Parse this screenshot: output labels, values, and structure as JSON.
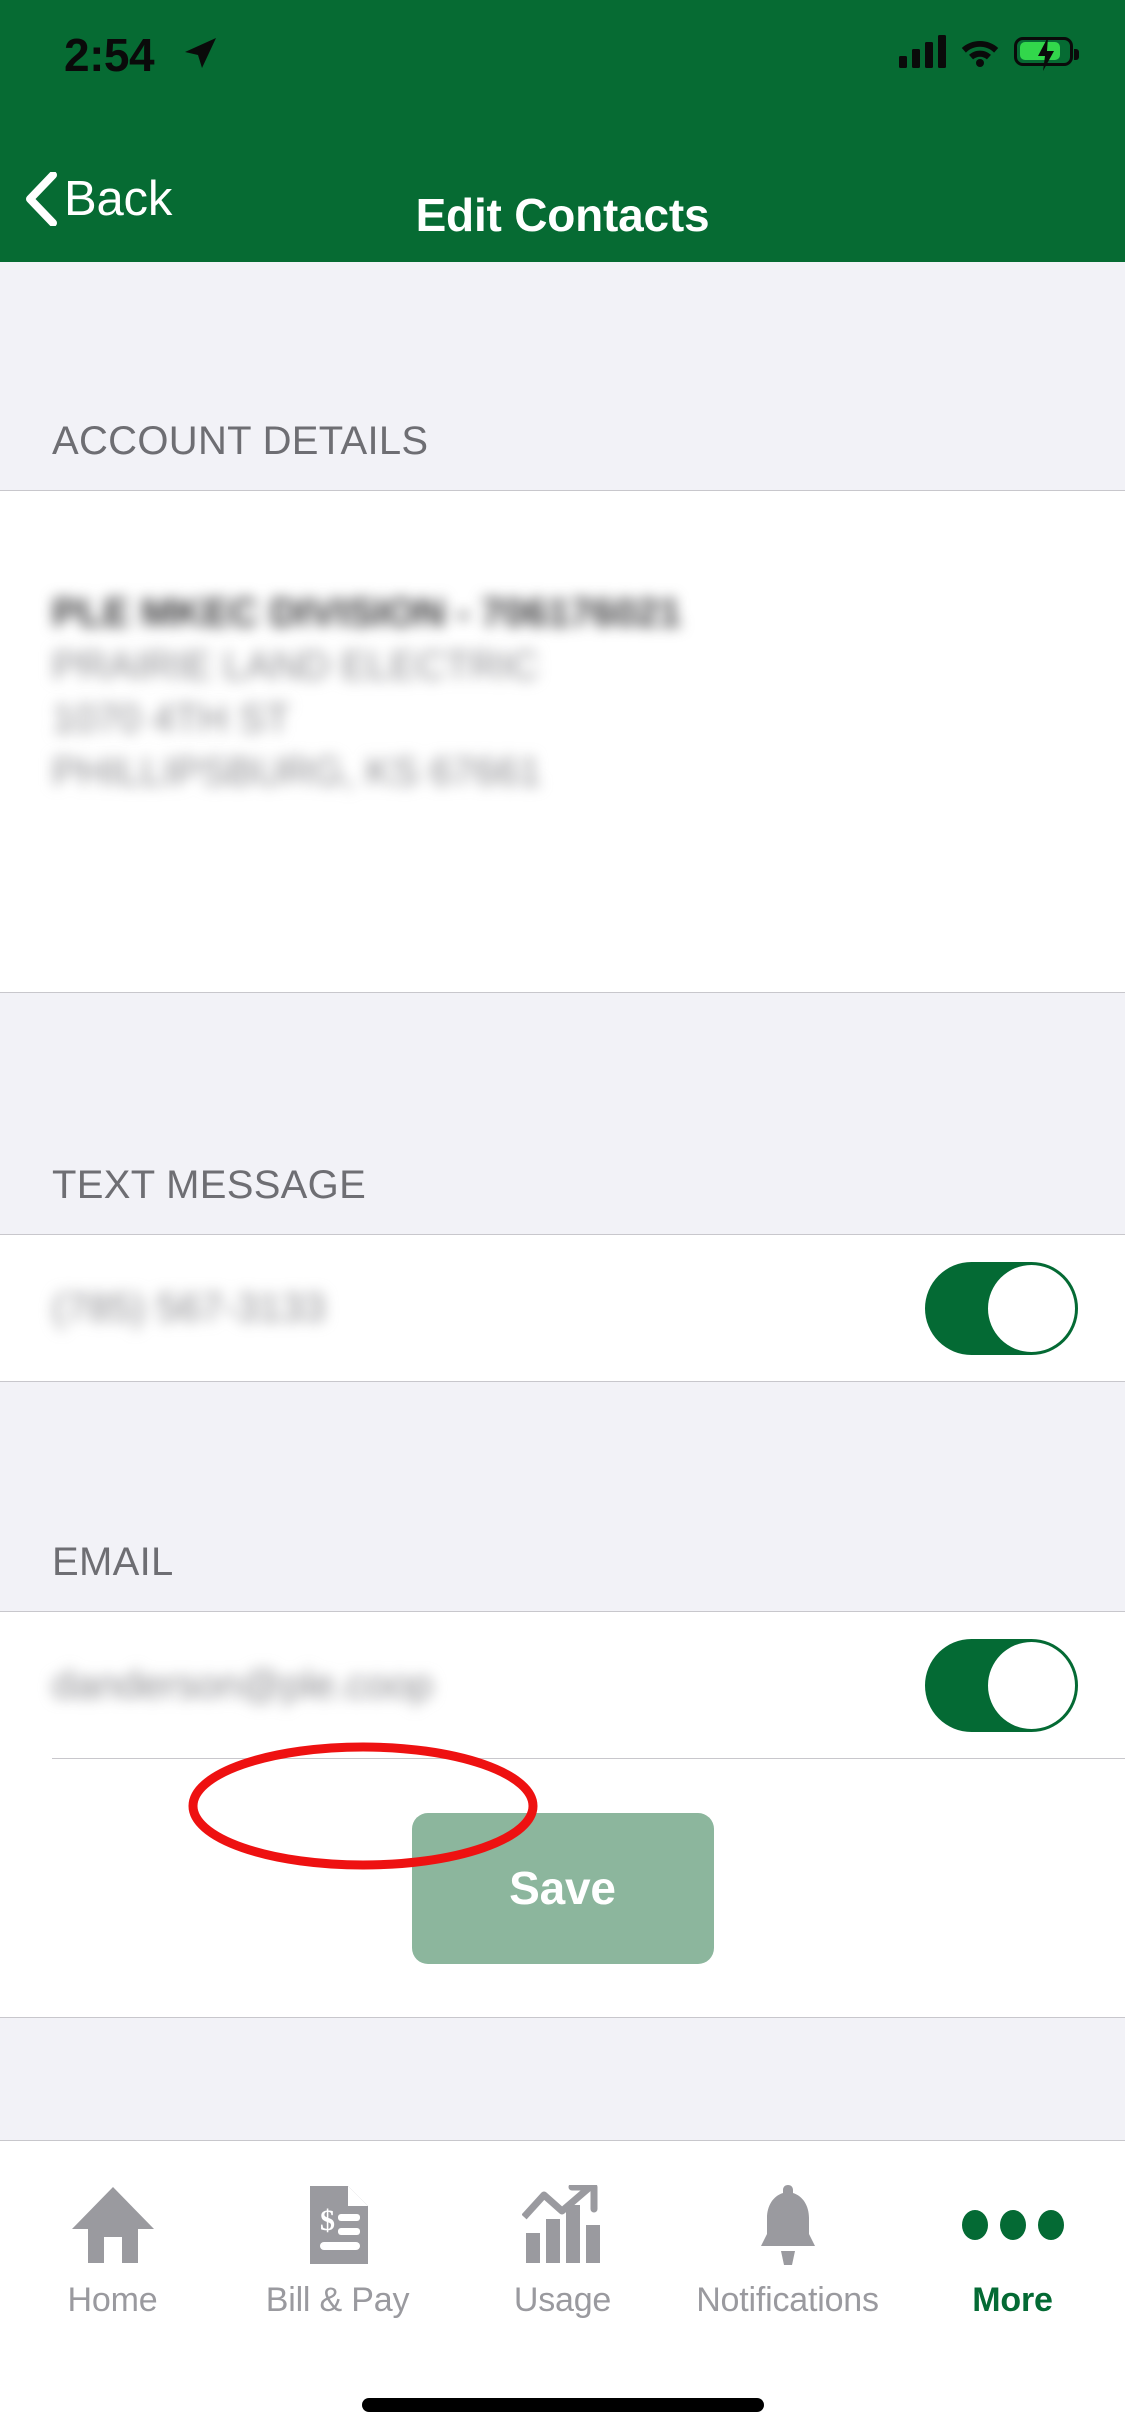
{
  "status_bar": {
    "time": "2:54",
    "location_icon": "location-arrow-icon",
    "signal_icon": "cellular-signal-icon",
    "wifi_icon": "wifi-icon",
    "battery_icon": "battery-charging-icon"
  },
  "nav": {
    "back_label": "Back",
    "back_icon": "chevron-left-icon",
    "title": "Edit Contacts"
  },
  "sections": {
    "account": {
      "header": "ACCOUNT DETAILS",
      "lines": [
        "PLE MKEC DIVISION - 706176021",
        "PRAIRIE LAND ELECTRIC",
        "1070 4TH ST",
        "PHILLIPSBURG, KS 67661"
      ]
    },
    "text_message": {
      "header": "TEXT MESSAGE",
      "value": "(785) 567-3133",
      "toggle_state": "on"
    },
    "email": {
      "header": "EMAIL",
      "value": "danderson@ple.coop",
      "toggle_state": "on"
    }
  },
  "save": {
    "label": "Save",
    "button_color": "#8CB69D",
    "annotation_color": "#ee1111",
    "annotation_shape": "ellipse"
  },
  "tabbar": {
    "items": [
      {
        "label": "Home",
        "icon": "home-icon",
        "active": false
      },
      {
        "label": "Bill & Pay",
        "icon": "invoice-icon",
        "active": false
      },
      {
        "label": "Usage",
        "icon": "bar-chart-arrow-icon",
        "active": false
      },
      {
        "label": "Notifications",
        "icon": "bell-icon",
        "active": false
      },
      {
        "label": "More",
        "icon": "three-dots-icon",
        "active": true
      }
    ]
  },
  "theme": {
    "brand_green": "#066B33",
    "toggle_green": "#046A34",
    "section_bg": "#f2f2f7",
    "header_text": "#6e6e73"
  }
}
